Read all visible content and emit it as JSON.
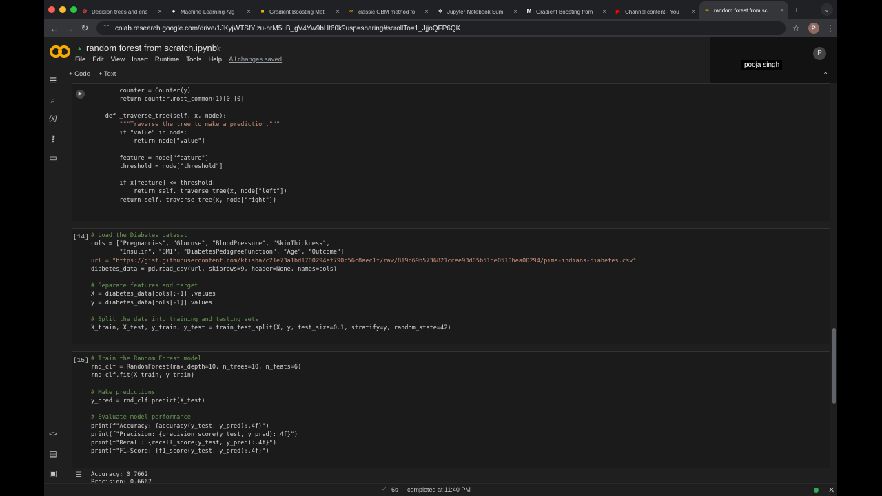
{
  "browser": {
    "tabs": [
      {
        "label": "Decision trees and ens",
        "icon": "gear-icon",
        "color": "#e8453c"
      },
      {
        "label": "Machine-Learning-Alg",
        "icon": "github-icon",
        "color": "#ffffff"
      },
      {
        "label": "Gradient Boosting Met",
        "icon": "slides-icon",
        "color": "#f4b400"
      },
      {
        "label": "classic GBM method fo",
        "icon": "colab-icon",
        "color": "#f9ab00"
      },
      {
        "label": "Jupyter Notebook Sum",
        "icon": "openai-icon",
        "color": "#dddddd"
      },
      {
        "label": "Gradient Boosting from",
        "icon": "medium-icon",
        "color": "#ffffff"
      },
      {
        "label": "Channel content - You",
        "icon": "youtube-icon",
        "color": "#ff0000"
      },
      {
        "label": "random forest from sc",
        "icon": "colab-icon",
        "color": "#f9ab00",
        "active": true
      }
    ],
    "url": "colab.research.google.com/drive/1JKyjWTSfYlzu-hrM5uB_gV4Yw9bHt60k?usp=sharing#scrollTo=1_JjjoQFP6QK",
    "profile_letter": "P"
  },
  "colab": {
    "notebook_title": "random forest from scratch.ipynb",
    "menu": [
      "File",
      "Edit",
      "View",
      "Insert",
      "Runtime",
      "Tools",
      "Help"
    ],
    "saved_status": "All changes saved",
    "add_code": "+ Code",
    "add_text": "+ Text"
  },
  "overlay": {
    "username": "pooja singh",
    "avatar_letter": "P"
  },
  "cells": [
    {
      "execution_count": "",
      "lines": [
        "        counter = Counter(y)",
        "        return counter.most_common(1)[0][0]",
        "",
        "    def _traverse_tree(self, x, node):",
        "        \"\"\"Traverse the tree to make a prediction.\"\"\"",
        "        if \"value\" in node:",
        "            return node[\"value\"]",
        "",
        "        feature = node[\"feature\"]",
        "        threshold = node[\"threshold\"]",
        "",
        "        if x[feature] <= threshold:",
        "            return self._traverse_tree(x, node[\"left\"])",
        "        return self._traverse_tree(x, node[\"right\"])"
      ]
    },
    {
      "execution_count": "[14]",
      "lines": [
        "# Load the Diabetes dataset",
        "cols = [\"Pregnancies\", \"Glucose\", \"BloodPressure\", \"SkinThickness\",",
        "        \"Insulin\", \"BMI\", \"DiabetesPedigreeFunction\", \"Age\", \"Outcome\"]",
        "url = \"https://gist.githubusercontent.com/ktisha/c21e73a1bd1700294ef790c56c8aec1f/raw/819b69b5736821ccee93d05b51de0510bea00294/pima-indians-diabetes.csv\"",
        "diabetes_data = pd.read_csv(url, skiprows=9, header=None, names=cols)",
        "",
        "# Separate features and target",
        "X = diabetes_data[cols[:-1]].values",
        "y = diabetes_data[cols[-1]].values",
        "",
        "# Split the data into training and testing sets",
        "X_train, X_test, y_train, y_test = train_test_split(X, y, test_size=0.1, stratify=y, random_state=42)"
      ]
    },
    {
      "execution_count": "[15]",
      "lines": [
        "# Train the Random Forest model",
        "rnd_clf = RandomForest(max_depth=10, n_trees=10, n_feats=6)",
        "rnd_clf.fit(X_train, y_train)",
        "",
        "# Make predictions",
        "y_pred = rnd_clf.predict(X_test)",
        "",
        "# Evaluate model performance",
        "print(f\"Accuracy: {accuracy(y_test, y_pred):.4f}\")",
        "print(f\"Precision: {precision_score(y_test, y_pred):.4f}\")",
        "print(f\"Recall: {recall_score(y_test, y_pred):.4f}\")",
        "print(f\"F1-Score: {f1_score(y_test, y_pred):.4f}\")"
      ]
    }
  ],
  "output": {
    "lines": [
      "Accuracy: 0.7662",
      "Precision: 0.6667"
    ]
  },
  "status": {
    "duration": "6s",
    "completed": "completed at 11:40 PM"
  }
}
